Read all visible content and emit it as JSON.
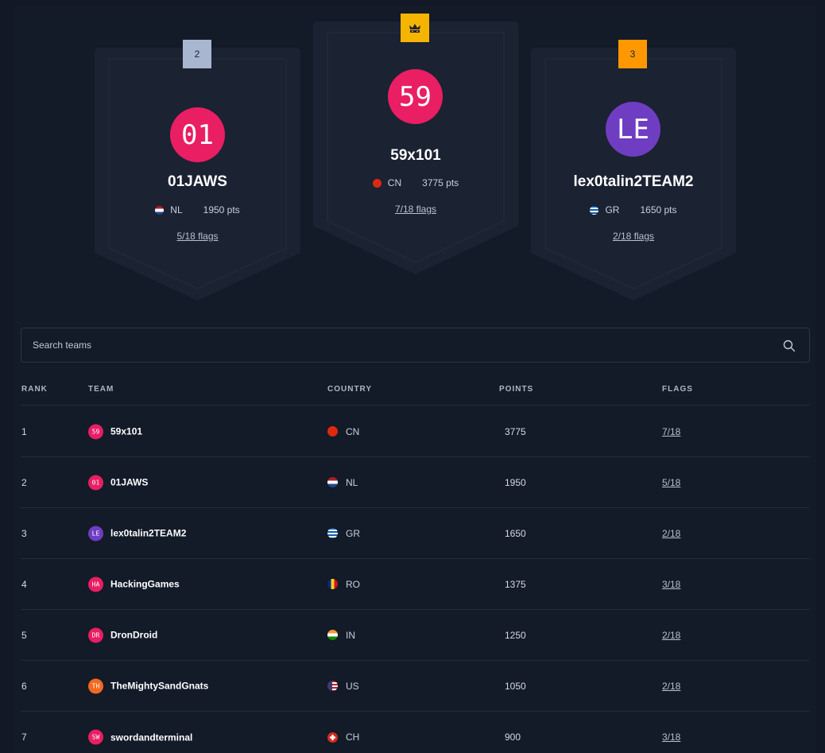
{
  "podium": [
    {
      "rank_label": "2",
      "initials": "01",
      "name": "01JAWS",
      "country": "NL",
      "points": "1950 pts",
      "flags": "5/18 flags",
      "avatar_color": "#e91e63",
      "badge_color": "#a9b6cf"
    },
    {
      "rank_label": "crown",
      "initials": "59",
      "name": "59x101",
      "country": "CN",
      "points": "3775 pts",
      "flags": "7/18 flags",
      "avatar_color": "#e91e63",
      "badge_color": "#f5b400"
    },
    {
      "rank_label": "3",
      "initials": "LE",
      "name": "lex0talin2TEAM2",
      "country": "GR",
      "points": "1650 pts",
      "flags": "2/18 flags",
      "avatar_color": "#6f3dc2",
      "badge_color": "#ff9800"
    }
  ],
  "search": {
    "placeholder": "Search teams"
  },
  "table": {
    "headers": {
      "rank": "RANK",
      "team": "TEAM",
      "country": "COUNTRY",
      "points": "POINTS",
      "flags": "FLAGS"
    },
    "rows": [
      {
        "rank": "1",
        "initials": "59",
        "team": "59x101",
        "country": "CN",
        "points": "3775",
        "flags": "7/18",
        "avatar_color": "#e91e63"
      },
      {
        "rank": "2",
        "initials": "01",
        "team": "01JAWS",
        "country": "NL",
        "points": "1950",
        "flags": "5/18",
        "avatar_color": "#e91e63"
      },
      {
        "rank": "3",
        "initials": "LE",
        "team": "lex0talin2TEAM2",
        "country": "GR",
        "points": "1650",
        "flags": "2/18",
        "avatar_color": "#6f3dc2"
      },
      {
        "rank": "4",
        "initials": "HA",
        "team": "HackingGames",
        "country": "RO",
        "points": "1375",
        "flags": "3/18",
        "avatar_color": "#e91e63"
      },
      {
        "rank": "5",
        "initials": "DR",
        "team": "DronDroid",
        "country": "IN",
        "points": "1250",
        "flags": "2/18",
        "avatar_color": "#e91e63"
      },
      {
        "rank": "6",
        "initials": "TH",
        "team": "TheMightySandGnats",
        "country": "US",
        "points": "1050",
        "flags": "2/18",
        "avatar_color": "#f26a21"
      },
      {
        "rank": "7",
        "initials": "SW",
        "team": "swordandterminal",
        "country": "CH",
        "points": "900",
        "flags": "3/18",
        "avatar_color": "#e91e63"
      }
    ]
  },
  "colors": {
    "background": "#121826",
    "card": "#1b2232",
    "card_border": "#222a3a"
  }
}
